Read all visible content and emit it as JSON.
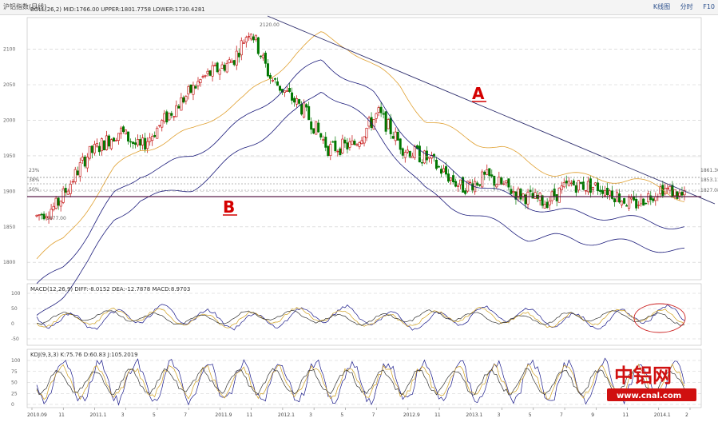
{
  "window": {
    "title": "沪铝指数(日线)",
    "right_links": [
      "K线图",
      "分时",
      "F10"
    ]
  },
  "main_panel": {
    "indicator_header": "BOLL(26,2)  MID:1766.00  UPPER:1801.7758  LOWER:1730.4281",
    "y_ticks": [
      "2100",
      "2050",
      "2000",
      "1950",
      "1900",
      "1850",
      "1800"
    ],
    "price_labels": {
      "high": "2120.00",
      "low": "1877.00",
      "fib_levels": [
        "1861.30",
        "1853.11",
        "1827.08"
      ],
      "fib_left": [
        "23%",
        "38%",
        "50%"
      ]
    },
    "annotations": {
      "A": "A",
      "B": "B"
    }
  },
  "macd_panel": {
    "header": "MACD(12,26,9)  DIFF:-8.0152  DEA:-12.7878  MACD:8.9703",
    "y_ticks": [
      "100",
      "50",
      "0",
      "-50"
    ]
  },
  "kdj_panel": {
    "header": "KDJ(9,3,3)  K:75.76  D:60.83  J:105.2019",
    "y_ticks": [
      "100",
      "75",
      "50",
      "25",
      "0"
    ]
  },
  "x_axis": {
    "ticks": [
      "2010.09",
      "11",
      "2011.1",
      "3",
      "5",
      "7",
      "2011.9",
      "11",
      "2012.1",
      "3",
      "5",
      "7",
      "2012.9",
      "11",
      "2013.1",
      "3",
      "5",
      "7",
      "9",
      "11",
      "2014.1",
      "2"
    ]
  },
  "watermark": {
    "brand": "中铝网",
    "url": "www.cnal.com"
  },
  "colors": {
    "up_candle": "#c00000",
    "down_candle": "#007700",
    "upper_band": "#e0a030",
    "mid_band": "#1a1a7a",
    "lower_band": "#1a1a7a",
    "trend_line": "#2c2c6c",
    "support_line": "#5a1f4a",
    "annotation": "#d40000",
    "watermark_red": "#d01010",
    "watermark_blue": "#1a4fb0"
  },
  "chart_data": {
    "type": "candlestick",
    "description_series": [
      {
        "name": "BOLL UPPER",
        "values": [
          1805,
          1830,
          1880,
          1930,
          1960,
          1970,
          1985,
          2010,
          2030,
          2060,
          2095,
          2120,
          2105,
          2075,
          2050,
          2000,
          1985,
          1970,
          1960,
          1940,
          1925,
          1920,
          1918,
          1915,
          1905,
          1890
        ]
      },
      {
        "name": "BOLL MID",
        "values": [
          1765,
          1795,
          1840,
          1895,
          1925,
          1935,
          1950,
          1975,
          2000,
          2030,
          2060,
          2085,
          2060,
          2035,
          1990,
          1950,
          1930,
          1910,
          1895,
          1880,
          1872,
          1868,
          1865,
          1860,
          1855,
          1850
        ]
      },
      {
        "name": "BOLL LOWER",
        "values": [
          1720,
          1755,
          1800,
          1860,
          1890,
          1895,
          1905,
          1930,
          1960,
          1985,
          2010,
          2045,
          2020,
          1990,
          1945,
          1900,
          1880,
          1865,
          1850,
          1835,
          1835,
          1830,
          1830,
          1825,
          1820,
          1815
        ]
      }
    ],
    "title": "",
    "xlabel": "",
    "ylabel": "",
    "ylim": [
      1780,
      2140
    ]
  }
}
